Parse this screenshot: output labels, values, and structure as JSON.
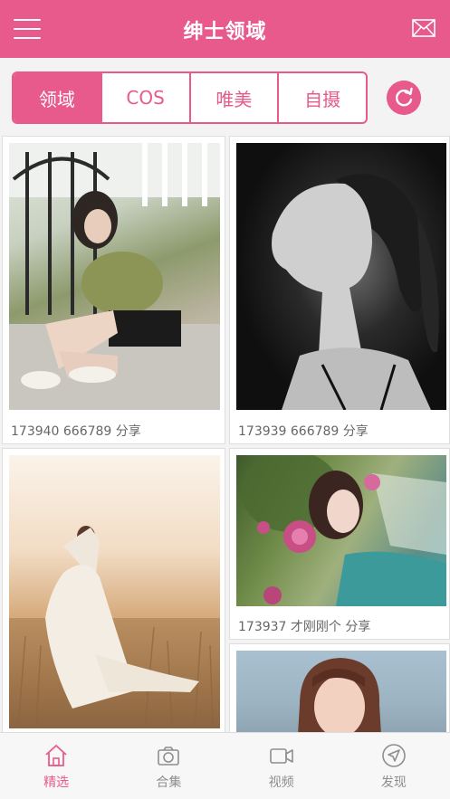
{
  "header": {
    "title": "绅士领域",
    "menu_icon": "hamburger-menu-icon",
    "mail_icon": "mail-icon"
  },
  "tabs": [
    {
      "label": "领域",
      "active": true
    },
    {
      "label": "COS",
      "active": false
    },
    {
      "label": "唯美",
      "active": false
    },
    {
      "label": "自摄",
      "active": false
    }
  ],
  "refresh_icon": "refresh-icon",
  "cards": [
    {
      "caption": "173940 666789 分享",
      "image": "woman sitting on steps by a gate"
    },
    {
      "caption": "173939 666789 分享",
      "image": "black and white profile portrait"
    },
    {
      "caption": "",
      "image": "woman in white dress in a sunlit field"
    },
    {
      "caption": "173937 才刚刚个 分享",
      "image": "woman among pink flowers"
    },
    {
      "caption": "",
      "image": "portrait on light blue background"
    }
  ],
  "bottom_nav": [
    {
      "label": "精选",
      "icon": "home-icon",
      "active": true
    },
    {
      "label": "合集",
      "icon": "camera-icon",
      "active": false
    },
    {
      "label": "视频",
      "icon": "video-icon",
      "active": false
    },
    {
      "label": "发现",
      "icon": "compass-icon",
      "active": false
    }
  ],
  "colors": {
    "accent": "#e85a8b",
    "background": "#f3f3f3",
    "nav_inactive": "#8e8e8e"
  }
}
